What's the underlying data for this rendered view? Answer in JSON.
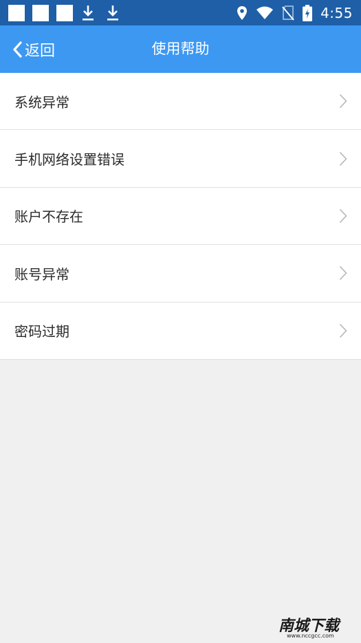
{
  "status_bar": {
    "time": "4:55",
    "notification_icons": [
      "notification-square",
      "notification-square",
      "notification-square",
      "download-icon",
      "download-icon"
    ],
    "icons_right": [
      "location-icon",
      "wifi-icon",
      "no-sim-icon",
      "battery-charging-icon"
    ],
    "background": "#1e5fa8"
  },
  "title_bar": {
    "back_label": "返回",
    "title": "使用帮助",
    "background": "#3d98f2"
  },
  "help_items": [
    {
      "label": "系统异常"
    },
    {
      "label": "手机网络设置错误"
    },
    {
      "label": "账户不存在"
    },
    {
      "label": "账号异常"
    },
    {
      "label": "密码过期"
    }
  ],
  "watermark": {
    "text": "南城下载",
    "sub": "www.nccgcc.com"
  }
}
